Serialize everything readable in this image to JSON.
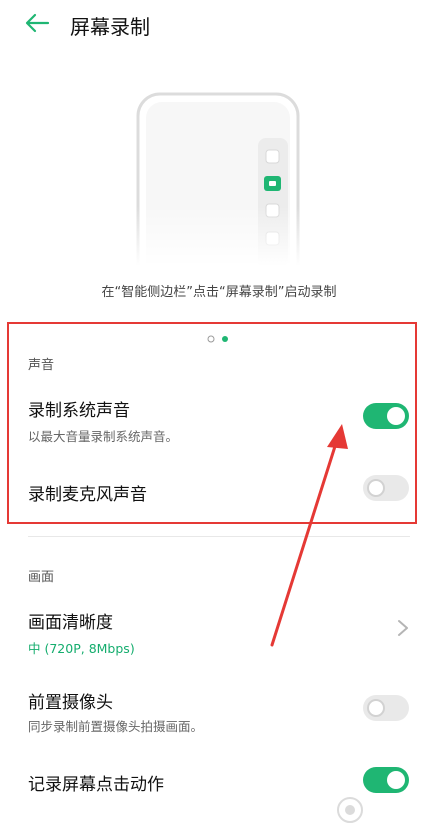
{
  "header": {
    "title": "屏幕录制"
  },
  "illustration": {
    "caption": "在“智能侧边栏”点击“屏幕录制”启动录制"
  },
  "pager": {
    "total": 2,
    "active": 2
  },
  "sound": {
    "section": "声音",
    "system": {
      "label": "录制系统声音",
      "desc": "以最大音量录制系统声音。",
      "enabled": true
    },
    "mic": {
      "label": "录制麦克风声音",
      "enabled": false
    }
  },
  "picture": {
    "section": "画面",
    "resolution": {
      "label": "画面清晰度",
      "value": "中 (720P, 8Mbps)"
    },
    "front_camera": {
      "label": "前置摄像头",
      "desc": "同步录制前置摄像头拍摄画面。",
      "enabled": false
    },
    "record_taps": {
      "label": "记录屏幕点击动作",
      "enabled": true
    }
  },
  "colors": {
    "accent": "#1fb673",
    "highlight": "#e53935"
  }
}
